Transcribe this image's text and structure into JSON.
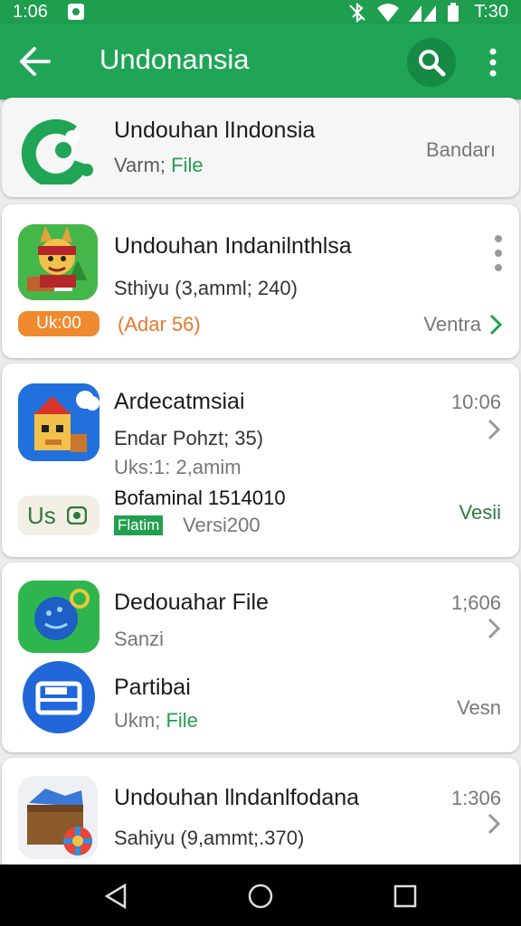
{
  "status": {
    "time_left": "1:06",
    "time_right": "T:30"
  },
  "appbar": {
    "title": "Undonansia"
  },
  "items": [
    {
      "title": "Undouhan lIndonsia",
      "sub_prefix": "Varm; ",
      "sub_green": "File",
      "right": "Bandarı"
    },
    {
      "title": "Undouhan Indanilnthlsa",
      "sub": "Sthiyu (3,amml; 240)",
      "badge": "Uk:00",
      "orange": "(Adar 56)",
      "right": "Ventra"
    },
    {
      "title": "Ardecatmsiai",
      "time": "10:06",
      "line2": "Endar Pohzt; 35)",
      "line3": "Uks:1: 2,amim",
      "badge": "Us",
      "title2": "Bofaminal 1514010",
      "green_badge": "Flatim",
      "version": "Versi200",
      "right": "Vesii"
    },
    {
      "title": "Dedouahar File",
      "time": "1;606",
      "sub": "Sanzi",
      "title2": "Partibai",
      "sub2_prefix": "Ukm; ",
      "sub2_green": "File",
      "right": "Vesn"
    },
    {
      "title": "Undouhan llndanlfodana",
      "time": "1:306",
      "sub": "Sahiyu (9,ammt;.370)"
    }
  ],
  "colors": {
    "appbar": "#20a557",
    "statusbar": "#1e9e4e",
    "accent": "#21a04e",
    "orange": "#e8782a"
  }
}
